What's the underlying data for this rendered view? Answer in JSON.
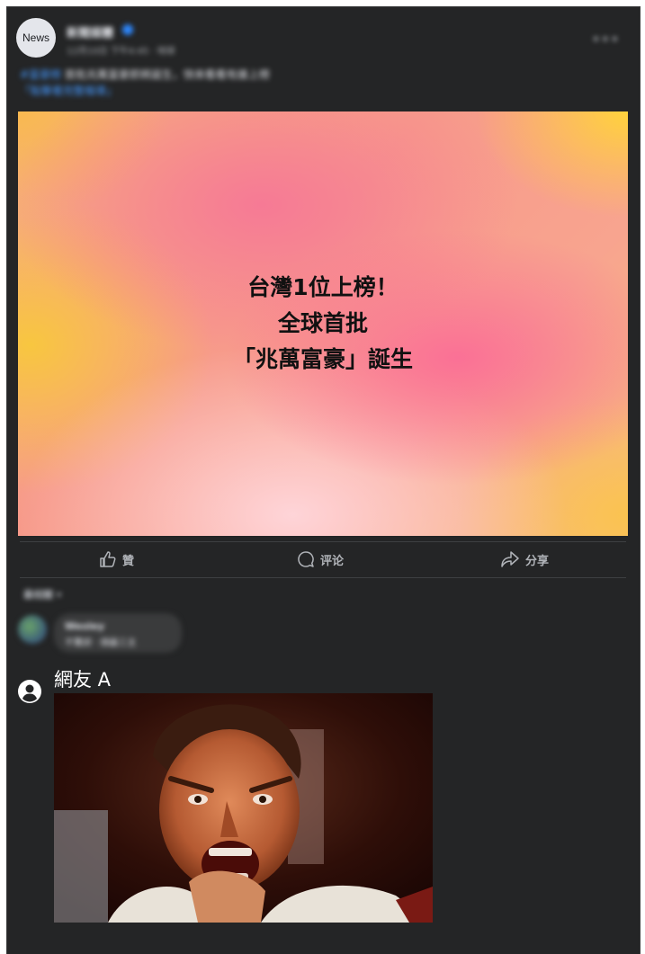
{
  "post": {
    "avatar_text": "News",
    "page_name": "新聞媒體",
    "time": "12月10日 下午4:45 · 地球",
    "caption_hashtag": "#富豪榜",
    "caption_text": "首批兆萬富豪即將誕生，快來看看有誰上榜",
    "caption_link": "「點擊看完整報導」"
  },
  "card": {
    "line1": "台灣﻿1位上榜！",
    "line2": "全球首批",
    "line3": "「兆萬富豪」誕生",
    "colors": {
      "pink": "#f86e96",
      "yellow": "#f8c83c",
      "peach": "#f6b07a"
    }
  },
  "actions": {
    "like_label": "贊",
    "comment_label": "评论",
    "share_label": "分享"
  },
  "comments": {
    "sort_label": "最相關",
    "first": {
      "name": "Wesley",
      "text": "不驚訝 · 錢最三主"
    },
    "second": {
      "name": "網友 A"
    }
  },
  "theme": {
    "background": "#242526",
    "text_primary": "#e4e6eb",
    "text_secondary": "#b0b3b8",
    "link": "#4599ff"
  }
}
